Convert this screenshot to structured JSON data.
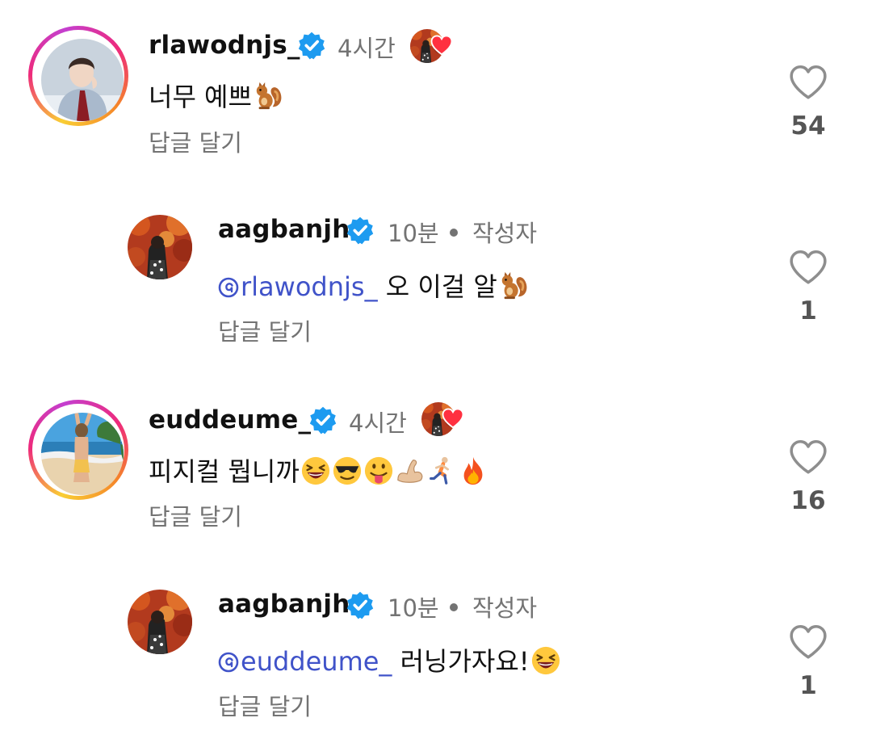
{
  "comments": [
    {
      "username": "rlawodnjs_",
      "time": "4시간",
      "text": "너무 예쁘",
      "reply_label": "답글 달기",
      "like_count": "54",
      "emojis": [
        "squirrel-emoji"
      ]
    },
    {
      "username": "aagbanjh",
      "time": "10분",
      "author_tag": "작성자",
      "mention": "rlawodnjs_",
      "text": " 오 이걸 알",
      "reply_label": "답글 달기",
      "like_count": "1",
      "emojis": [
        "squirrel-emoji"
      ]
    },
    {
      "username": "euddeume_",
      "time": "4시간",
      "text": "피지컬 뭡니까",
      "reply_label": "답글 달기",
      "like_count": "16",
      "emojis": [
        "laughing-emoji",
        "sunglasses-emoji",
        "tongue-emoji",
        "flexed-biceps-emoji",
        "runner-emoji",
        "fire-emoji"
      ]
    },
    {
      "username": "aagbanjh",
      "time": "10분",
      "author_tag": "작성자",
      "mention": "euddeume_",
      "text": " 러닝가자요!",
      "reply_label": "답글 달기",
      "like_count": "1",
      "emojis": [
        "laughing-emoji"
      ]
    }
  ],
  "colors": {
    "mention": "#4053c9",
    "verified": "#1d9bf0",
    "heart_badge": "#ff3040",
    "meta_text": "#737373"
  }
}
